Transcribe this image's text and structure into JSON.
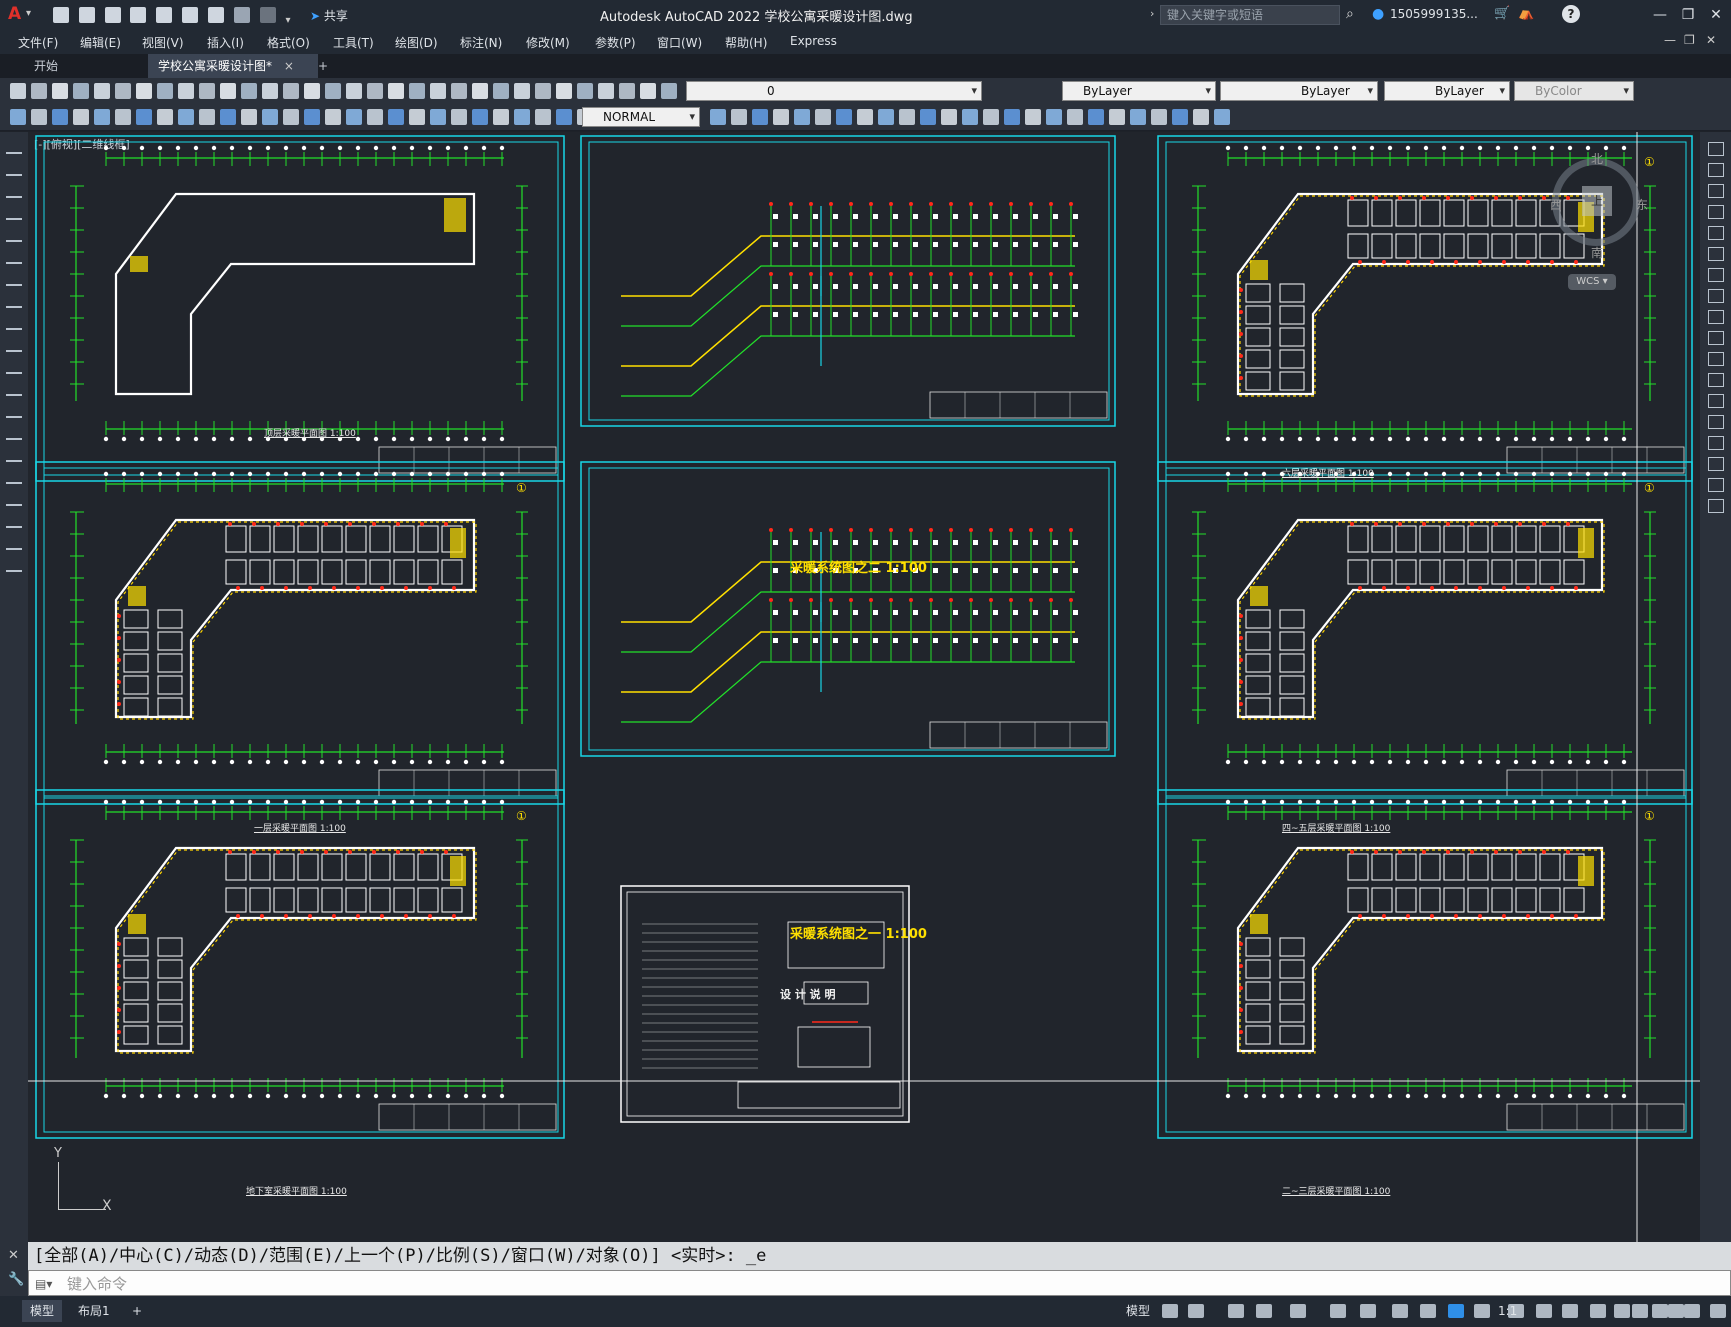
{
  "app": {
    "title": "Autodesk AutoCAD 2022    学校公寓采暖设计图.dwg",
    "logo_letter": "A",
    "share_label": "共享",
    "search_placeholder": "键入关键字或短语",
    "user_label": "1505999135...",
    "window_controls": [
      "minimize-icon",
      "restore-icon",
      "close-icon"
    ]
  },
  "menu": [
    {
      "label": "文件(F)"
    },
    {
      "label": "编辑(E)"
    },
    {
      "label": "视图(V)"
    },
    {
      "label": "插入(I)"
    },
    {
      "label": "格式(O)"
    },
    {
      "label": "工具(T)"
    },
    {
      "label": "绘图(D)"
    },
    {
      "label": "标注(N)"
    },
    {
      "label": "修改(M)"
    },
    {
      "label": "参数(P)"
    },
    {
      "label": "窗口(W)"
    },
    {
      "label": "帮助(H)"
    },
    {
      "label": "Express"
    }
  ],
  "tabs": [
    {
      "label": "开始"
    },
    {
      "label": "学校公寓采暖设计图*",
      "close": "×"
    },
    {
      "label": "+"
    }
  ],
  "toolbar": {
    "layer_value": "0",
    "color_value": "ByLayer",
    "linetype_value": "ByLayer",
    "lineweight_value": "ByLayer",
    "plotstyle_value": "ByColor",
    "dimstyle_value": "NORMAL"
  },
  "viewport_label": "[-][俯视][二维线框]",
  "viewcube": {
    "north": "北",
    "south": "南",
    "east": "东",
    "west": "西",
    "top": "上",
    "wcs": "WCS"
  },
  "sheets": [
    {
      "caption": "顶层采暖平面图 1:100",
      "kind": "roof"
    },
    {
      "caption": "采暖系统图之二 1:100",
      "kind": "system"
    },
    {
      "caption": "六层采暖平面图 1:100",
      "kind": "floor"
    },
    {
      "caption": "一层采暖平面图 1:100",
      "kind": "floor"
    },
    {
      "caption": "采暖系统图之一 1:100",
      "kind": "system"
    },
    {
      "caption": "四~五层采暖平面图 1:100",
      "kind": "floor"
    },
    {
      "caption": "地下室采暖平面图 1:100",
      "kind": "floor"
    },
    {
      "caption": "设计说明",
      "kind": "notes"
    },
    {
      "caption": "二~三层采暖平面图 1:100",
      "kind": "floor"
    }
  ],
  "notes_sheet": {
    "title": "设 计 说 明"
  },
  "command": {
    "history": "[全部(A)/中心(C)/动态(D)/范围(E)/上一个(P)/比例(S)/窗口(W)/对象(O)] <实时>: _e",
    "placeholder": "键入命令"
  },
  "status": {
    "model_tab": "模型",
    "layout_tab": "布局1",
    "add_tab": "+",
    "model_label": "模型",
    "scale_label": "1:1"
  },
  "ucs": {
    "x": "X",
    "y": "Y"
  }
}
